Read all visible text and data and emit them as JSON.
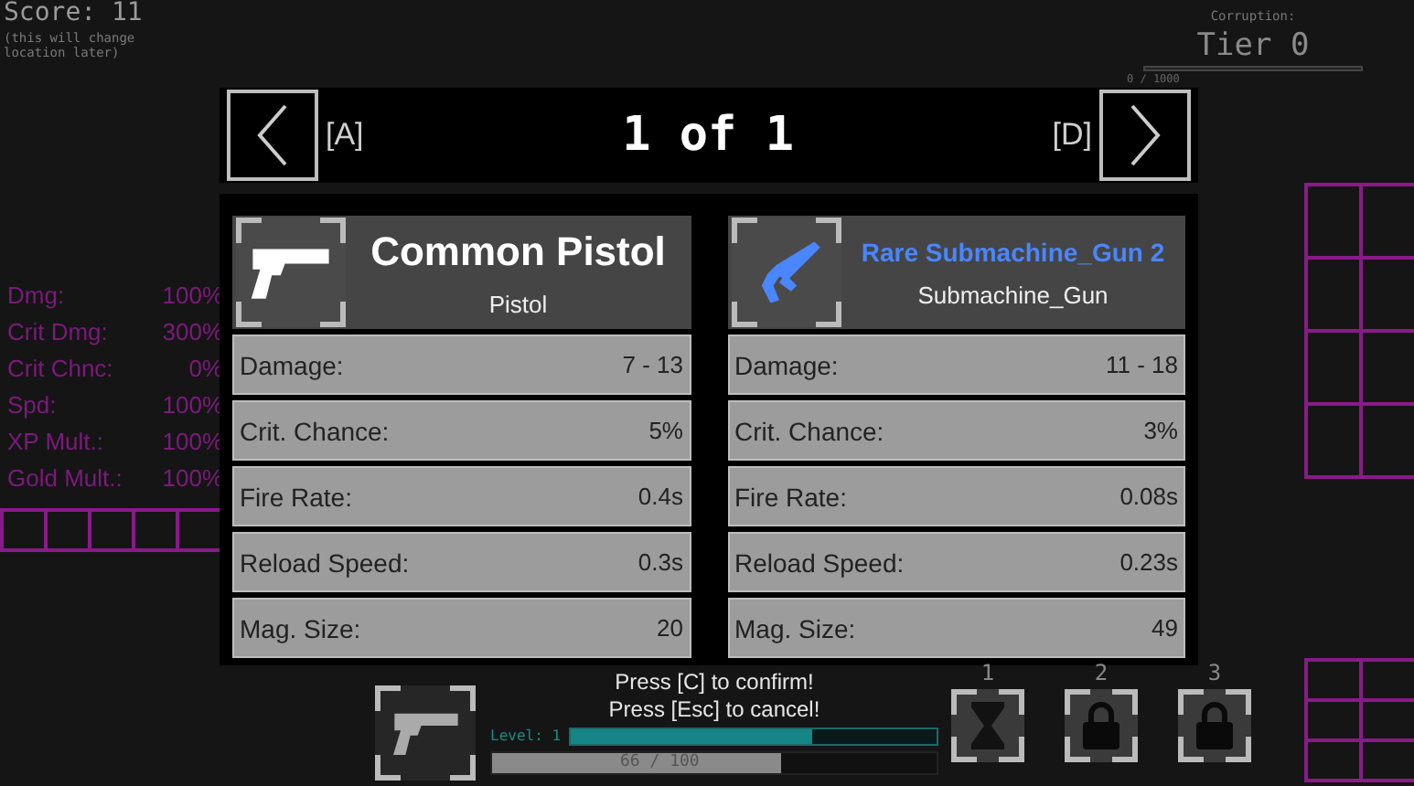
{
  "score": {
    "label": "Score: 11",
    "note": "(this will change location later)"
  },
  "corruption": {
    "label": "Corruption:",
    "tier": "Tier 0",
    "reading": "0 / 1000",
    "level": 0
  },
  "pager": {
    "prev_key": "[A]",
    "counter": "1 of 1",
    "next_key": "[D]"
  },
  "weapons": [
    {
      "name": "Common Pistol",
      "type": "Pistol",
      "color": "#ffffff",
      "kind": "pistol",
      "stats": [
        {
          "label": "Damage:",
          "value": "7 - 13"
        },
        {
          "label": "Crit. Chance:",
          "value": "5%"
        },
        {
          "label": "Fire Rate:",
          "value": "0.4s"
        },
        {
          "label": "Reload Speed:",
          "value": "0.3s"
        },
        {
          "label": "Mag. Size:",
          "value": "20"
        }
      ]
    },
    {
      "name": "Rare Submachine_Gun 2",
      "type": "Submachine_Gun",
      "color": "#4a86ff",
      "kind": "smg",
      "stats": [
        {
          "label": "Damage:",
          "value": "11 - 18"
        },
        {
          "label": "Crit. Chance:",
          "value": "3%"
        },
        {
          "label": "Fire Rate:",
          "value": "0.08s"
        },
        {
          "label": "Reload Speed:",
          "value": "0.23s"
        },
        {
          "label": "Mag. Size:",
          "value": "49"
        }
      ]
    }
  ],
  "player_stats": [
    {
      "label": "Dmg:",
      "value": "100%"
    },
    {
      "label": "Crit Dmg:",
      "value": "300%"
    },
    {
      "label": "Crit Chnc:",
      "value": "0%"
    },
    {
      "label": "Spd:",
      "value": "100%"
    },
    {
      "label": "XP Mult.:",
      "value": "100%"
    },
    {
      "label": "Gold Mult.:",
      "value": "100%"
    }
  ],
  "prompts": [
    "Press [C] to confirm!",
    "Press [Esc] to cancel!"
  ],
  "level": {
    "label": "Level: 1",
    "level": 0.66
  },
  "xp": {
    "reading": "66 / 100",
    "level": 0.65
  },
  "abilities": [
    {
      "key": "1",
      "kind": "cooldown"
    },
    {
      "key": "2",
      "kind": "locked"
    },
    {
      "key": "3",
      "kind": "locked"
    }
  ]
}
